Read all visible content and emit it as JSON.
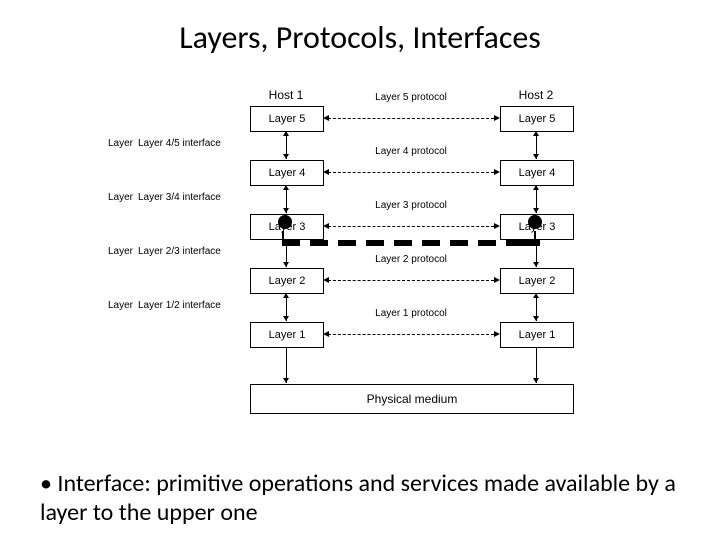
{
  "title": "Layers, Protocols, Interfaces",
  "hosts": {
    "left": "Host 1",
    "right": "Host 2"
  },
  "layers": [
    "Layer 5",
    "Layer 4",
    "Layer 3",
    "Layer 2",
    "Layer 1"
  ],
  "protocols": [
    "Layer 5 protocol",
    "Layer 4 protocol",
    "Layer 3 protocol",
    "Layer 2 protocol",
    "Layer 1 protocol"
  ],
  "interfaces": [
    "Layer 4/5 interface",
    "Layer 3/4 interface",
    "Layer 2/3 interface",
    "Layer 1/2 interface"
  ],
  "iface_prefix": "Layer",
  "medium": "Physical medium",
  "bullet": "Interface: primitive operations and services made available by a layer to the upper one"
}
